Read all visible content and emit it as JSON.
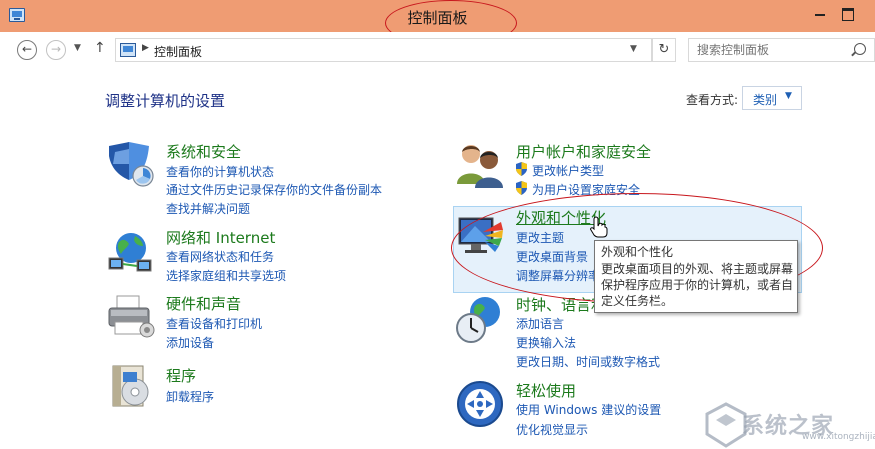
{
  "window": {
    "title": "控制面板",
    "colors": {
      "titlebar": "#ef9c73",
      "annotation": "#c8181e"
    }
  },
  "navbar": {
    "breadcrumb": "控制面板",
    "search_placeholder": "搜索控制面板"
  },
  "content": {
    "heading": "调整计算机的设置",
    "view_by_label": "查看方式:",
    "view_by_value": "类别"
  },
  "categories": {
    "system": {
      "title": "系统和安全",
      "icon": "shield-icon",
      "links": [
        "查看你的计算机状态",
        "通过文件历史记录保存你的文件备份副本",
        "查找并解决问题"
      ]
    },
    "network": {
      "title": "网络和 Internet",
      "icon": "network-globe-icon",
      "links": [
        "查看网络状态和任务",
        "选择家庭组和共享选项"
      ]
    },
    "hardware": {
      "title": "硬件和声音",
      "icon": "printer-icon",
      "links": [
        "查看设备和打印机",
        "添加设备"
      ]
    },
    "programs": {
      "title": "程序",
      "icon": "programs-icon",
      "links": [
        "卸载程序"
      ]
    },
    "users": {
      "title": "用户帐户和家庭安全",
      "icon": "users-icon",
      "links": [
        "更改帐户类型",
        "为用户设置家庭安全"
      ]
    },
    "appearance": {
      "title": "外观和个性化",
      "icon": "appearance-icon",
      "links": [
        "更改主题",
        "更改桌面背景",
        "调整屏幕分辨率"
      ]
    },
    "clock": {
      "title": "时钟、语言和区域",
      "icon": "clock-globe-icon",
      "links": [
        "添加语言",
        "更换输入法",
        "更改日期、时间或数字格式"
      ]
    },
    "ease": {
      "title": "轻松使用",
      "icon": "ease-of-access-icon",
      "links": [
        "使用 Windows 建议的设置",
        "优化视觉显示"
      ]
    }
  },
  "tooltip": {
    "title": "外观和个性化",
    "lines": [
      "更改桌面项目的外观、将主题或屏幕",
      "保护程序应用于你的计算机，或者自",
      "定义任务栏。"
    ]
  },
  "watermark": {
    "text": "系统之家",
    "url": "www.xitongzhijia.net"
  }
}
